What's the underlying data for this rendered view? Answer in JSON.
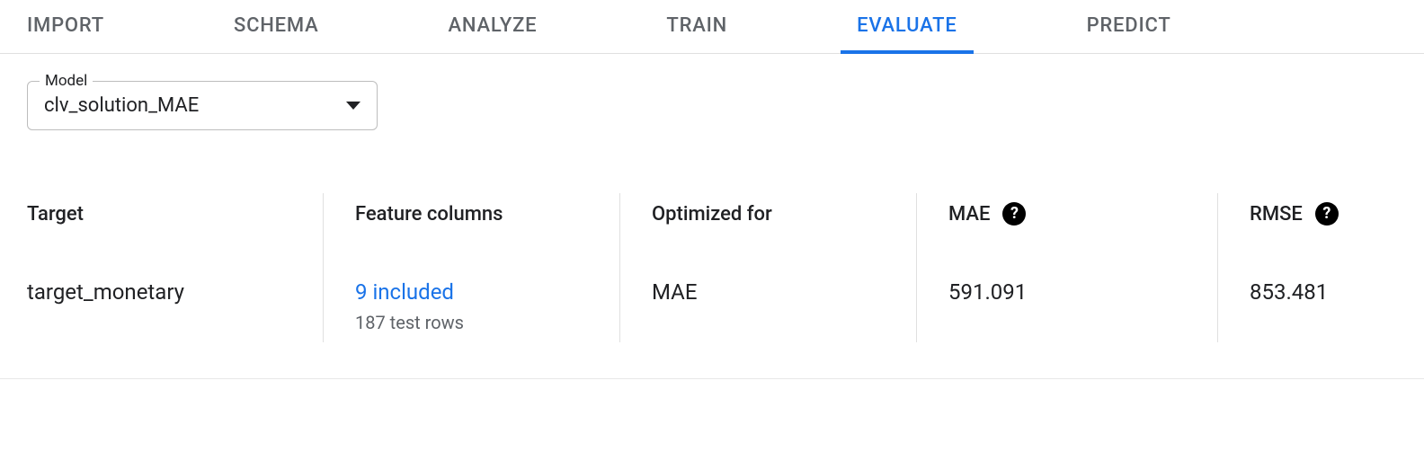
{
  "tabs": {
    "import": "IMPORT",
    "schema": "SCHEMA",
    "analyze": "ANALYZE",
    "train": "TRAIN",
    "evaluate": "EVALUATE",
    "predict": "PREDICT"
  },
  "model": {
    "label": "Model",
    "selected": "clv_solution_MAE"
  },
  "metrics": {
    "target": {
      "label": "Target",
      "value": "target_monetary"
    },
    "features": {
      "label": "Feature columns",
      "value": "9 included",
      "sub": "187 test rows"
    },
    "optimized": {
      "label": "Optimized for",
      "value": "MAE"
    },
    "mae": {
      "label": "MAE",
      "value": "591.091"
    },
    "rmse": {
      "label": "RMSE",
      "value": "853.481"
    }
  }
}
